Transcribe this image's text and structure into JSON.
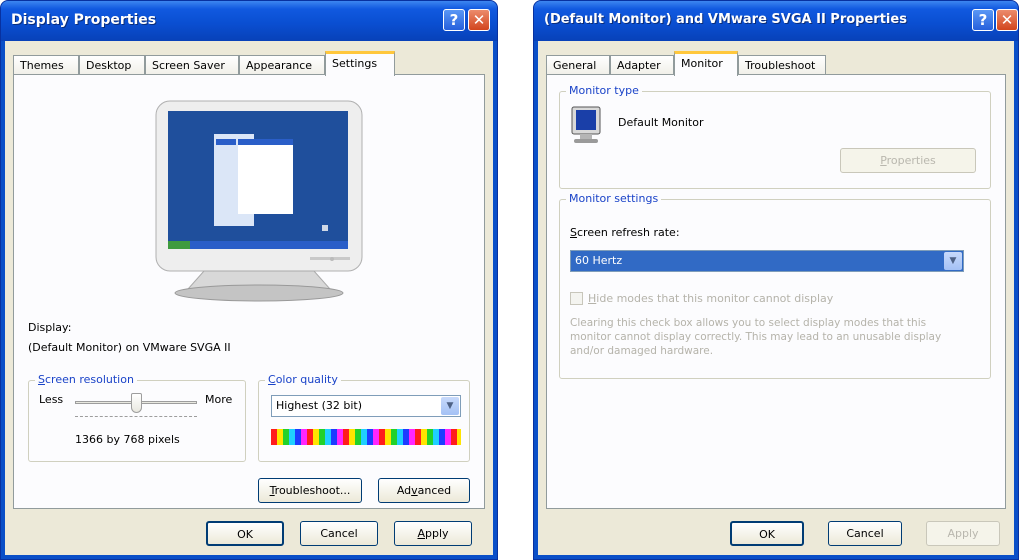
{
  "left": {
    "title": "Display Properties",
    "tabs": [
      "Themes",
      "Desktop",
      "Screen Saver",
      "Appearance",
      "Settings"
    ],
    "active_tab": "Settings",
    "display_label": "Display:",
    "display_value": "(Default Monitor) on VMware SVGA II",
    "resolution": {
      "legend_u": "S",
      "legend_rest": "creen resolution",
      "less": "Less",
      "more": "More",
      "value": "1366 by 768 pixels",
      "slider_position": 0.5
    },
    "color_quality": {
      "legend_u": "C",
      "legend_rest": "olor quality",
      "selected": "Highest (32 bit)"
    },
    "troubleshoot_u": "T",
    "troubleshoot_rest": "roubleshoot...",
    "advanced_pre": "Ad",
    "advanced_u": "v",
    "advanced_post": "anced",
    "ok": "OK",
    "cancel": "Cancel",
    "apply_u": "A",
    "apply_rest": "pply"
  },
  "right": {
    "title": "(Default Monitor) and VMware SVGA II Properties",
    "tabs": [
      "General",
      "Adapter",
      "Monitor",
      "Troubleshoot"
    ],
    "active_tab": "Monitor",
    "monitor_type": {
      "legend": "Monitor type",
      "name": "Default Monitor",
      "properties_u": "P",
      "properties_rest": "roperties"
    },
    "monitor_settings": {
      "legend": "Monitor settings",
      "refresh_u": "S",
      "refresh_rest": "creen refresh rate:",
      "refresh_value": "60 Hertz",
      "hide_u": "H",
      "hide_rest": "ide modes that this monitor cannot display",
      "hide_checked": false,
      "note": "Clearing this check box allows you to select display modes that this monitor cannot display correctly. This may lead to an unusable display and/or damaged hardware."
    },
    "ok": "OK",
    "cancel": "Cancel",
    "apply": "Apply"
  },
  "colors": {
    "titlebar": "#0a4fd2",
    "dialog_bg": "#ece9d8",
    "panel_bg": "#fcfcfe",
    "legend_text": "#1a43c8",
    "selection": "#316ac5",
    "active_tab_accent": "#ffc73c",
    "close_button": "#d2451e"
  }
}
